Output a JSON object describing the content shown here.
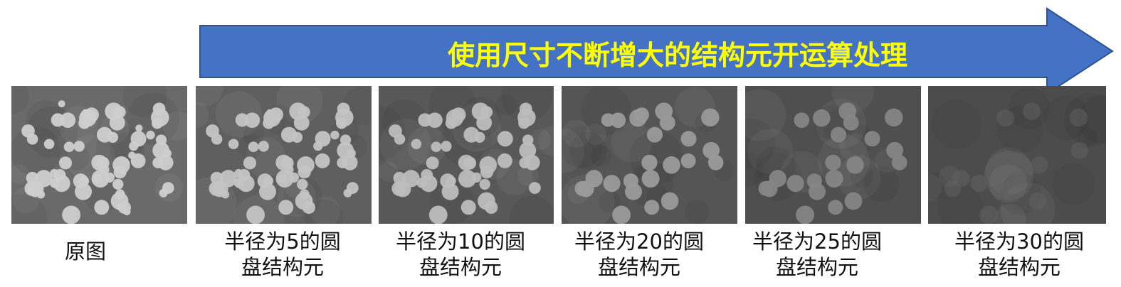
{
  "banner": {
    "text": "使用尺寸不断增大的结构元开运算处理",
    "fill": "#4472c4",
    "stroke": "#2f528f",
    "text_color": "#ffff00"
  },
  "panels": [
    {
      "line1": "原图",
      "line2": "",
      "tone": 0
    },
    {
      "line1": "半径为5的圆",
      "line2": "盘结构元",
      "tone": 1
    },
    {
      "line1": "半径为10的圆",
      "line2": "盘结构元",
      "tone": 2
    },
    {
      "line1": "半径为20的圆",
      "line2": "盘结构元",
      "tone": 3
    },
    {
      "line1": "半径为25的圆",
      "line2": "盘结构元",
      "tone": 4
    },
    {
      "line1": "半径为30的圆",
      "line2": "盘结构元",
      "tone": 5
    }
  ]
}
